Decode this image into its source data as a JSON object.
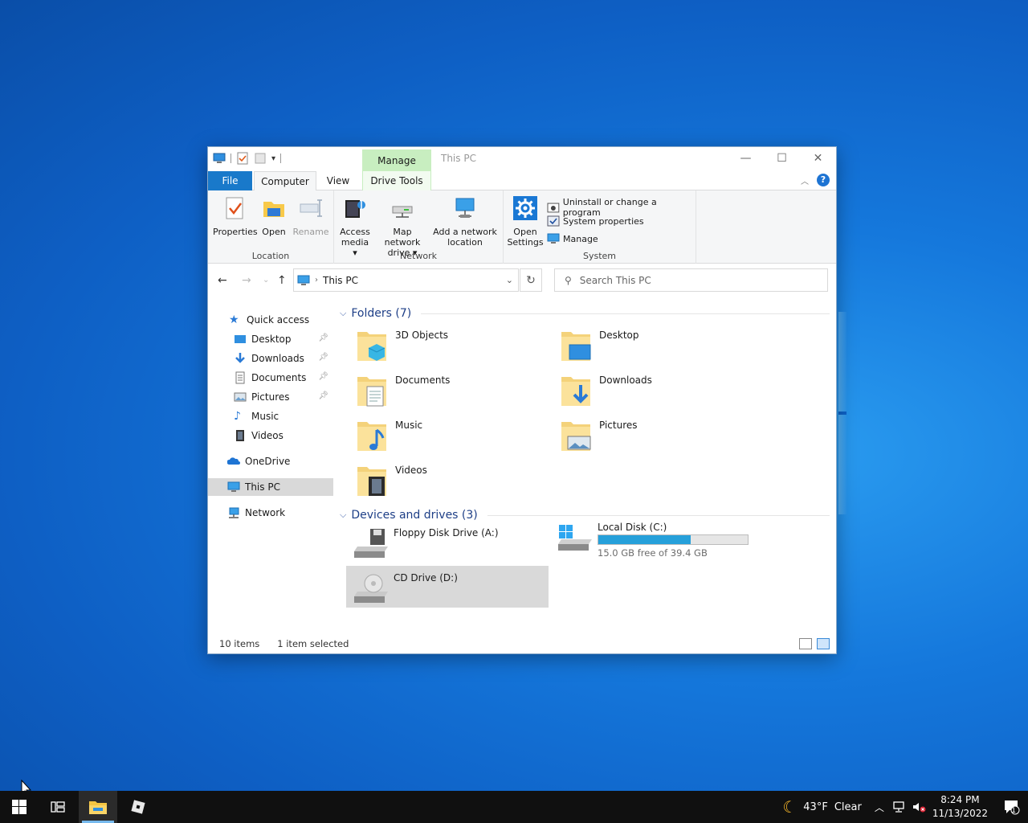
{
  "window": {
    "title": "This PC",
    "contextual_tab": "Manage"
  },
  "tabs": {
    "file": "File",
    "computer": "Computer",
    "view": "View",
    "drive_tools": "Drive Tools"
  },
  "ribbon": {
    "location": {
      "label": "Location",
      "properties": "Properties",
      "open": "Open",
      "rename": "Rename"
    },
    "network": {
      "label": "Network",
      "access_media_1": "Access",
      "access_media_2": "media ▾",
      "map_drive_1": "Map network",
      "map_drive_2": "drive ▾",
      "add_location_1": "Add a network",
      "add_location_2": "location"
    },
    "system": {
      "label": "System",
      "open_settings_1": "Open",
      "open_settings_2": "Settings",
      "uninstall": "Uninstall or change a program",
      "system_properties": "System properties",
      "manage": "Manage"
    }
  },
  "address": {
    "path": "This PC",
    "search_placeholder": "Search This PC"
  },
  "nav": {
    "quick_access": "Quick access",
    "items": [
      "Desktop",
      "Downloads",
      "Documents",
      "Pictures",
      "Music",
      "Videos"
    ],
    "onedrive": "OneDrive",
    "this_pc": "This PC",
    "network": "Network"
  },
  "folders": {
    "heading": "Folders (7)",
    "items": [
      "3D Objects",
      "Desktop",
      "Documents",
      "Downloads",
      "Music",
      "Pictures",
      "Videos"
    ]
  },
  "drives": {
    "heading": "Devices and drives (3)",
    "floppy": "Floppy Disk Drive (A:)",
    "local": "Local Disk (C:)",
    "local_usage": "15.0 GB free of 39.4 GB",
    "local_used_fraction": 0.62,
    "cd": "CD Drive (D:)"
  },
  "status": {
    "items": "10 items",
    "selected": "1 item selected"
  },
  "taskbar": {
    "weather_temp": "43°F",
    "weather_cond": "Clear",
    "time": "8:24 PM",
    "date": "11/13/2022",
    "notif_count": "1"
  }
}
